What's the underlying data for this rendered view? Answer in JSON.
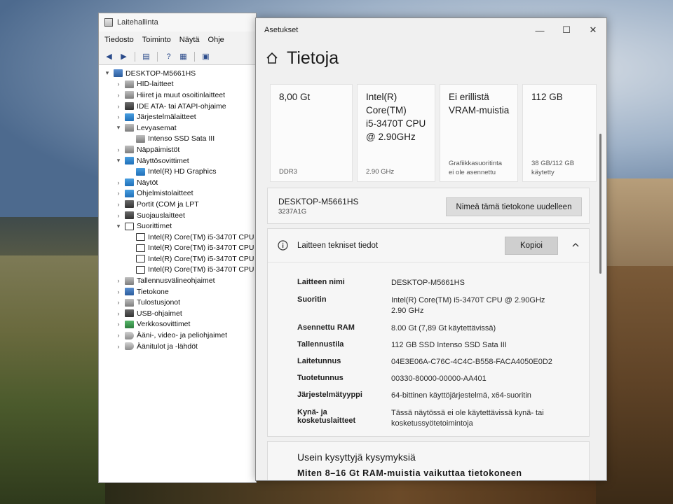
{
  "device_manager": {
    "title": "Laitehallinta",
    "menu": [
      "Tiedosto",
      "Toiminto",
      "Näytä",
      "Ohje"
    ],
    "tree": [
      {
        "label": "DESKTOP-M5661HS",
        "level": 0,
        "state": "expanded",
        "icon": "computer-icon"
      },
      {
        "label": "HID-laitteet",
        "level": 1,
        "state": "collapsed",
        "icon": "hid-icon"
      },
      {
        "label": "Hiiret ja muut osoitinlaitteet",
        "level": 1,
        "state": "collapsed",
        "icon": "mouse-icon"
      },
      {
        "label": "IDE ATA- tai ATAPI-ohjaime",
        "level": 1,
        "state": "collapsed",
        "icon": "ide-icon"
      },
      {
        "label": "Järjestelmälaitteet",
        "level": 1,
        "state": "collapsed",
        "icon": "system-devices-icon"
      },
      {
        "label": "Levyasemat",
        "level": 1,
        "state": "expanded",
        "icon": "disk-drive-icon"
      },
      {
        "label": "Intenso SSD Sata III",
        "level": 2,
        "state": "leaf",
        "icon": "disk-drive-icon"
      },
      {
        "label": "Näppäimistöt",
        "level": 1,
        "state": "collapsed",
        "icon": "keyboard-icon"
      },
      {
        "label": "Näyttösovittimet",
        "level": 1,
        "state": "expanded",
        "icon": "display-adapter-icon"
      },
      {
        "label": "Intel(R) HD Graphics",
        "level": 2,
        "state": "leaf",
        "icon": "display-adapter-icon"
      },
      {
        "label": "Näytöt",
        "level": 1,
        "state": "collapsed",
        "icon": "monitor-icon"
      },
      {
        "label": "Ohjelmistolaitteet",
        "level": 1,
        "state": "collapsed",
        "icon": "software-device-icon"
      },
      {
        "label": "Portit (COM ja LPT",
        "level": 1,
        "state": "collapsed",
        "icon": "port-icon"
      },
      {
        "label": "Suojauslaitteet",
        "level": 1,
        "state": "collapsed",
        "icon": "security-device-icon"
      },
      {
        "label": "Suorittimet",
        "level": 1,
        "state": "expanded",
        "icon": "processor-icon"
      },
      {
        "label": "Intel(R) Core(TM) i5-3470T CPU",
        "level": 2,
        "state": "leaf",
        "icon": "processor-icon"
      },
      {
        "label": "Intel(R) Core(TM) i5-3470T CPU",
        "level": 2,
        "state": "leaf",
        "icon": "processor-icon"
      },
      {
        "label": "Intel(R) Core(TM) i5-3470T CPU",
        "level": 2,
        "state": "leaf",
        "icon": "processor-icon"
      },
      {
        "label": "Intel(R) Core(TM) i5-3470T CPU",
        "level": 2,
        "state": "leaf",
        "icon": "processor-icon"
      },
      {
        "label": "Tallennusvälineohjaimet",
        "level": 1,
        "state": "collapsed",
        "icon": "storage-controller-icon"
      },
      {
        "label": "Tietokone",
        "level": 1,
        "state": "collapsed",
        "icon": "computer-icon"
      },
      {
        "label": "Tulostusjonot",
        "level": 1,
        "state": "collapsed",
        "icon": "print-queue-icon"
      },
      {
        "label": "USB-ohjaimet",
        "level": 1,
        "state": "collapsed",
        "icon": "usb-icon"
      },
      {
        "label": "Verkkosovittimet",
        "level": 1,
        "state": "collapsed",
        "icon": "network-adapter-icon"
      },
      {
        "label": "Ääni-, video- ja peliohjaimet",
        "level": 1,
        "state": "collapsed",
        "icon": "sound-icon"
      },
      {
        "label": "Äänitulot ja -lähdöt",
        "level": 1,
        "state": "collapsed",
        "icon": "audio-io-icon"
      }
    ]
  },
  "settings": {
    "window_title": "Asetukset",
    "page_title": "Tietoja",
    "cards": [
      {
        "value": "8,00 Gt",
        "sub": "DDR3"
      },
      {
        "value": "Intel(R)\nCore(TM)\ni5-3470T CPU\n@ 2.90GHz",
        "sub": "2.90 GHz"
      },
      {
        "value": "Ei erillistä\nVRAM-muistia",
        "sub": "Grafiikkasuoritinta\nei ole asennettu"
      },
      {
        "value": "112 GB",
        "sub": "38 GB/112 GB\nkäytetty"
      }
    ],
    "device": {
      "name": "DESKTOP-M5661HS",
      "model": "3237A1G",
      "rename_button": "Nimeä tämä tietokone uudelleen"
    },
    "specs": {
      "title": "Laitteen tekniset tiedot",
      "copy_button": "Kopioi",
      "rows": [
        {
          "label": "Laitteen nimi",
          "value": "DESKTOP-M5661HS"
        },
        {
          "label": "Suoritin",
          "value": "Intel(R) Core(TM) i5-3470T CPU @ 2.90GHz\n2.90 GHz"
        },
        {
          "label": "Asennettu RAM",
          "value": "8.00 Gt (7,89 Gt käytettävissä)"
        },
        {
          "label": "Tallennustila",
          "value": "112 GB SSD Intenso SSD Sata III"
        },
        {
          "label": "Laitetunnus",
          "value": "04E3E06A-C76C-4C4C-B558-FACA4050E0D2"
        },
        {
          "label": "Tuotetunnus",
          "value": "00330-80000-00000-AA401"
        },
        {
          "label": "Järjestelmätyyppi",
          "value": "64-bittinen käyttöjärjestelmä, x64-suoritin"
        },
        {
          "label": "Kynä- ja kosketuslaitteet",
          "value": "Tässä näytössä ei ole käytettävissä kynä- tai kosketussyötetoimintoja"
        }
      ]
    },
    "faq": {
      "title": "Usein kysyttyjä kysymyksiä",
      "first_question": "Miten 8–16 Gt RAM-muistia vaikuttaa tietokoneen"
    }
  }
}
